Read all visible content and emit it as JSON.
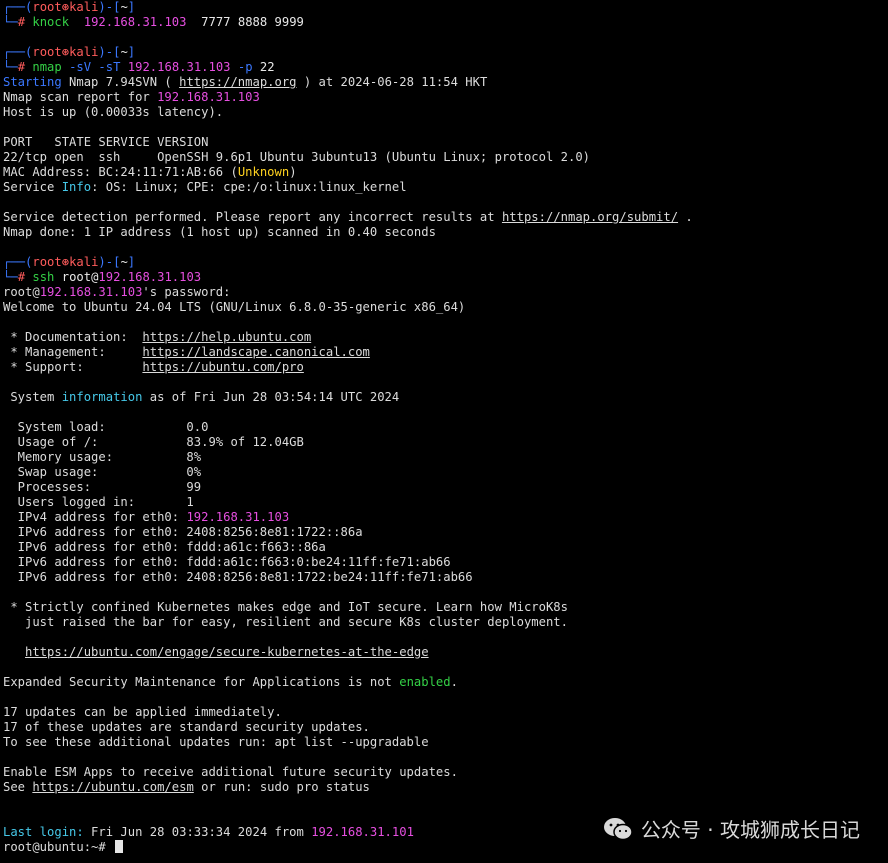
{
  "prompt": {
    "user": "root",
    "skull": "⊛",
    "host": "kali",
    "dir": "~"
  },
  "cmd1": {
    "name": "knock",
    "ip": "192.168.31.103",
    "ports": "7777 8888 9999"
  },
  "cmd2": {
    "name": "nmap",
    "flags": "-sV -sT",
    "ip": "192.168.31.103",
    "pflag": "-p",
    "port": "22"
  },
  "nmap": {
    "start_word": "Starting",
    "start_mid": "Nmap 7.94SVN ( ",
    "start_url": "https://nmap.org",
    "start_end": " ) at 2024-06-28 11:54 HKT",
    "report_pre": "Nmap scan report for ",
    "report_ip": "192.168.31.103",
    "host_up": "Host is up (0.00033s latency).",
    "header": "PORT   STATE SERVICE VERSION",
    "port_line": "22/tcp open  ssh     OpenSSH 9.6p1 Ubuntu 3ubuntu13 (Ubuntu Linux; protocol 2.0)",
    "mac_pre": "MAC Address: BC:24:11:71:AB:66 (",
    "mac_unknown": "Unknown",
    "mac_post": ")",
    "svc_pre": "Service ",
    "svc_info": "Info",
    "svc_post": ": OS: Linux; CPE: cpe:/o:linux:linux_kernel",
    "detect_pre": "Service detection performed. Please report any incorrect results at ",
    "detect_url": "https://nmap.org/submit/",
    "detect_post": " .",
    "done": "Nmap done: 1 IP address (1 host up) scanned in 0.40 seconds"
  },
  "cmd3": {
    "name": "ssh",
    "target_pre": "root@",
    "ip": "192.168.31.103"
  },
  "ssh": {
    "pw_pre": "root@",
    "pw_ip": "192.168.31.103",
    "pw_post": "'s password:",
    "welcome": "Welcome to Ubuntu 24.04 LTS (GNU/Linux 6.8.0-35-generic x86_64)",
    "doc_label": " * Documentation:  ",
    "doc_url": "https://help.ubuntu.com",
    "mgmt_label": " * Management:     ",
    "mgmt_url": "https://landscape.canonical.com",
    "sup_label": " * Support:        ",
    "sup_url": "https://ubuntu.com/pro",
    "sys_pre": " System ",
    "sys_info": "information",
    "sys_post": " as of Fri Jun 28 03:54:14 UTC 2024",
    "stats": [
      "  System load:           0.0",
      "  Usage of /:            83.9% of 12.04GB",
      "  Memory usage:          8%",
      "  Swap usage:            0%",
      "  Processes:             99",
      "  Users logged in:       1"
    ],
    "ipv4_pre": "  IPv4 address for eth0: ",
    "ipv4_ip": "192.168.31.103",
    "ipv6": [
      "  IPv6 address for eth0: 2408:8256:8e81:1722::86a",
      "  IPv6 address for eth0: fddd:a61c:f663::86a",
      "  IPv6 address for eth0: fddd:a61c:f663:0:be24:11ff:fe71:ab66",
      "  IPv6 address for eth0: 2408:8256:8e81:1722:be24:11ff:fe71:ab66"
    ],
    "k8s_1": " * Strictly confined Kubernetes makes edge and IoT secure. Learn how MicroK8s",
    "k8s_2": "   just raised the bar for easy, resilient and secure K8s cluster deployment.",
    "k8s_url_pad": "   ",
    "k8s_url": "https://ubuntu.com/engage/secure-kubernetes-at-the-edge",
    "esm_pre": "Expanded Security Maintenance for Applications is not ",
    "esm_enabled": "enabled",
    "esm_post": ".",
    "upd_1": "17 updates can be applied immediately.",
    "upd_2": "17 of these updates are standard security updates.",
    "upd_3": "To see these additional updates run: apt list --upgradable",
    "esm_apps": "Enable ESM Apps to receive additional future security updates.",
    "see_pre": "See ",
    "see_url": "https://ubuntu.com/esm",
    "see_post": " or run: sudo pro status",
    "last_label": "Last login:",
    "last_mid": " Fri Jun 28 03:33:34 2024 from ",
    "last_ip": "192.168.31.101",
    "final_prompt": "root@ubuntu:~# "
  },
  "watermark": {
    "text": "公众号 · 攻城狮成长日记",
    "icon": "wechat-icon"
  },
  "colors": {
    "prompt": "#3b78ff",
    "user": "#ff5c5c",
    "accent": "#46c8e8",
    "ip": "#e64fe0",
    "unknown": "#ffd21f",
    "enabled": "#34d046",
    "bg": "#000000"
  }
}
